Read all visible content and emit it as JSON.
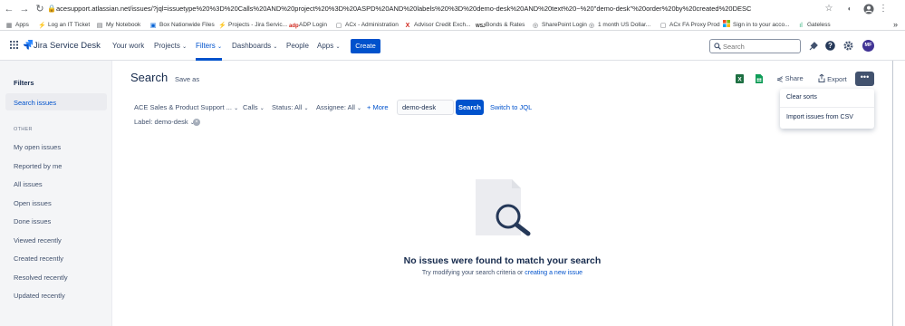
{
  "browser": {
    "url": "acesupport.atlassian.net/issues/?jql=issuetype%20%3D%20Calls%20AND%20project%20%3D%20ASPD%20AND%20labels%20%3D%20demo-desk%20AND%20text%20~%20\"demo-desk\"%20order%20by%20created%20DESC",
    "bookmarks": [
      {
        "label": "Apps",
        "icon": "apps-grid-icon",
        "color": "#5f6368"
      },
      {
        "label": "Log an IT Ticket",
        "icon": "jira-icon",
        "color": "#2684ff"
      },
      {
        "label": "My Notebook",
        "icon": "notebook-icon",
        "color": "#5f6368"
      },
      {
        "label": "Box Nationwide Files",
        "icon": "box-icon",
        "color": "#0061d5"
      },
      {
        "label": "Projects - Jira Servic...",
        "icon": "jira-icon",
        "color": "#2684ff"
      },
      {
        "label": "ADP Login",
        "icon": "adp-icon",
        "color": "#d0271d"
      },
      {
        "label": "ACx - Administration",
        "icon": "page-icon",
        "color": "#5f6368"
      },
      {
        "label": "Advisor Credit Exch...",
        "icon": "x-icon",
        "color": "#d0271d"
      },
      {
        "label": "Bonds & Rates",
        "icon": "wsj-icon",
        "color": "#333333"
      },
      {
        "label": "SharePoint Login",
        "icon": "globe-icon",
        "color": "#5f6368"
      },
      {
        "label": "1 month US Dollar...",
        "icon": "globe-icon",
        "color": "#5f6368"
      },
      {
        "label": "ACx FA Proxy Prod",
        "icon": "page-icon",
        "color": "#5f6368"
      },
      {
        "label": "Sign in to your acco...",
        "icon": "microsoft-icon",
        "color": "#f25022"
      },
      {
        "label": "Gateless",
        "icon": "gateless-icon",
        "color": "#36b37e"
      }
    ],
    "overflow": "»"
  },
  "jira": {
    "product": "Jira Service Desk",
    "nav": [
      "Your work",
      "Projects",
      "Filters",
      "Dashboards",
      "People",
      "Apps"
    ],
    "create_label": "Create",
    "search_placeholder": "Search",
    "avatar_initials": "MF",
    "avatar_color": "#403294"
  },
  "sidebar": {
    "heading": "Filters",
    "active_item": "Search issues",
    "section_label": "OTHER",
    "items": [
      "My open issues",
      "Reported by me",
      "All issues",
      "Open issues",
      "Done issues",
      "Viewed recently",
      "Created recently",
      "Resolved recently",
      "Updated recently"
    ]
  },
  "main": {
    "title": "Search",
    "save_as": "Save as",
    "filters": {
      "project": "ACE Sales & Product Support ...",
      "type": "Calls",
      "status": "Status: All",
      "assignee": "Assignee: All",
      "more": "+ More",
      "text_value": "demo-desk",
      "search_button": "Search",
      "switch_jql": "Switch to JQL",
      "label_chip": "Label: demo-desk"
    },
    "actions": {
      "share": "Share",
      "export": "Export",
      "more": "•••"
    },
    "dropdown": [
      "Clear sorts",
      "Import issues from CSV"
    ],
    "empty": {
      "title": "No issues were found to match your search",
      "subtitle_prefix": "Try modifying your search criteria or",
      "subtitle_link": "creating a new issue"
    }
  },
  "colors": {
    "accent": "#0052cc",
    "sidebar_bg": "#f4f5f7"
  }
}
